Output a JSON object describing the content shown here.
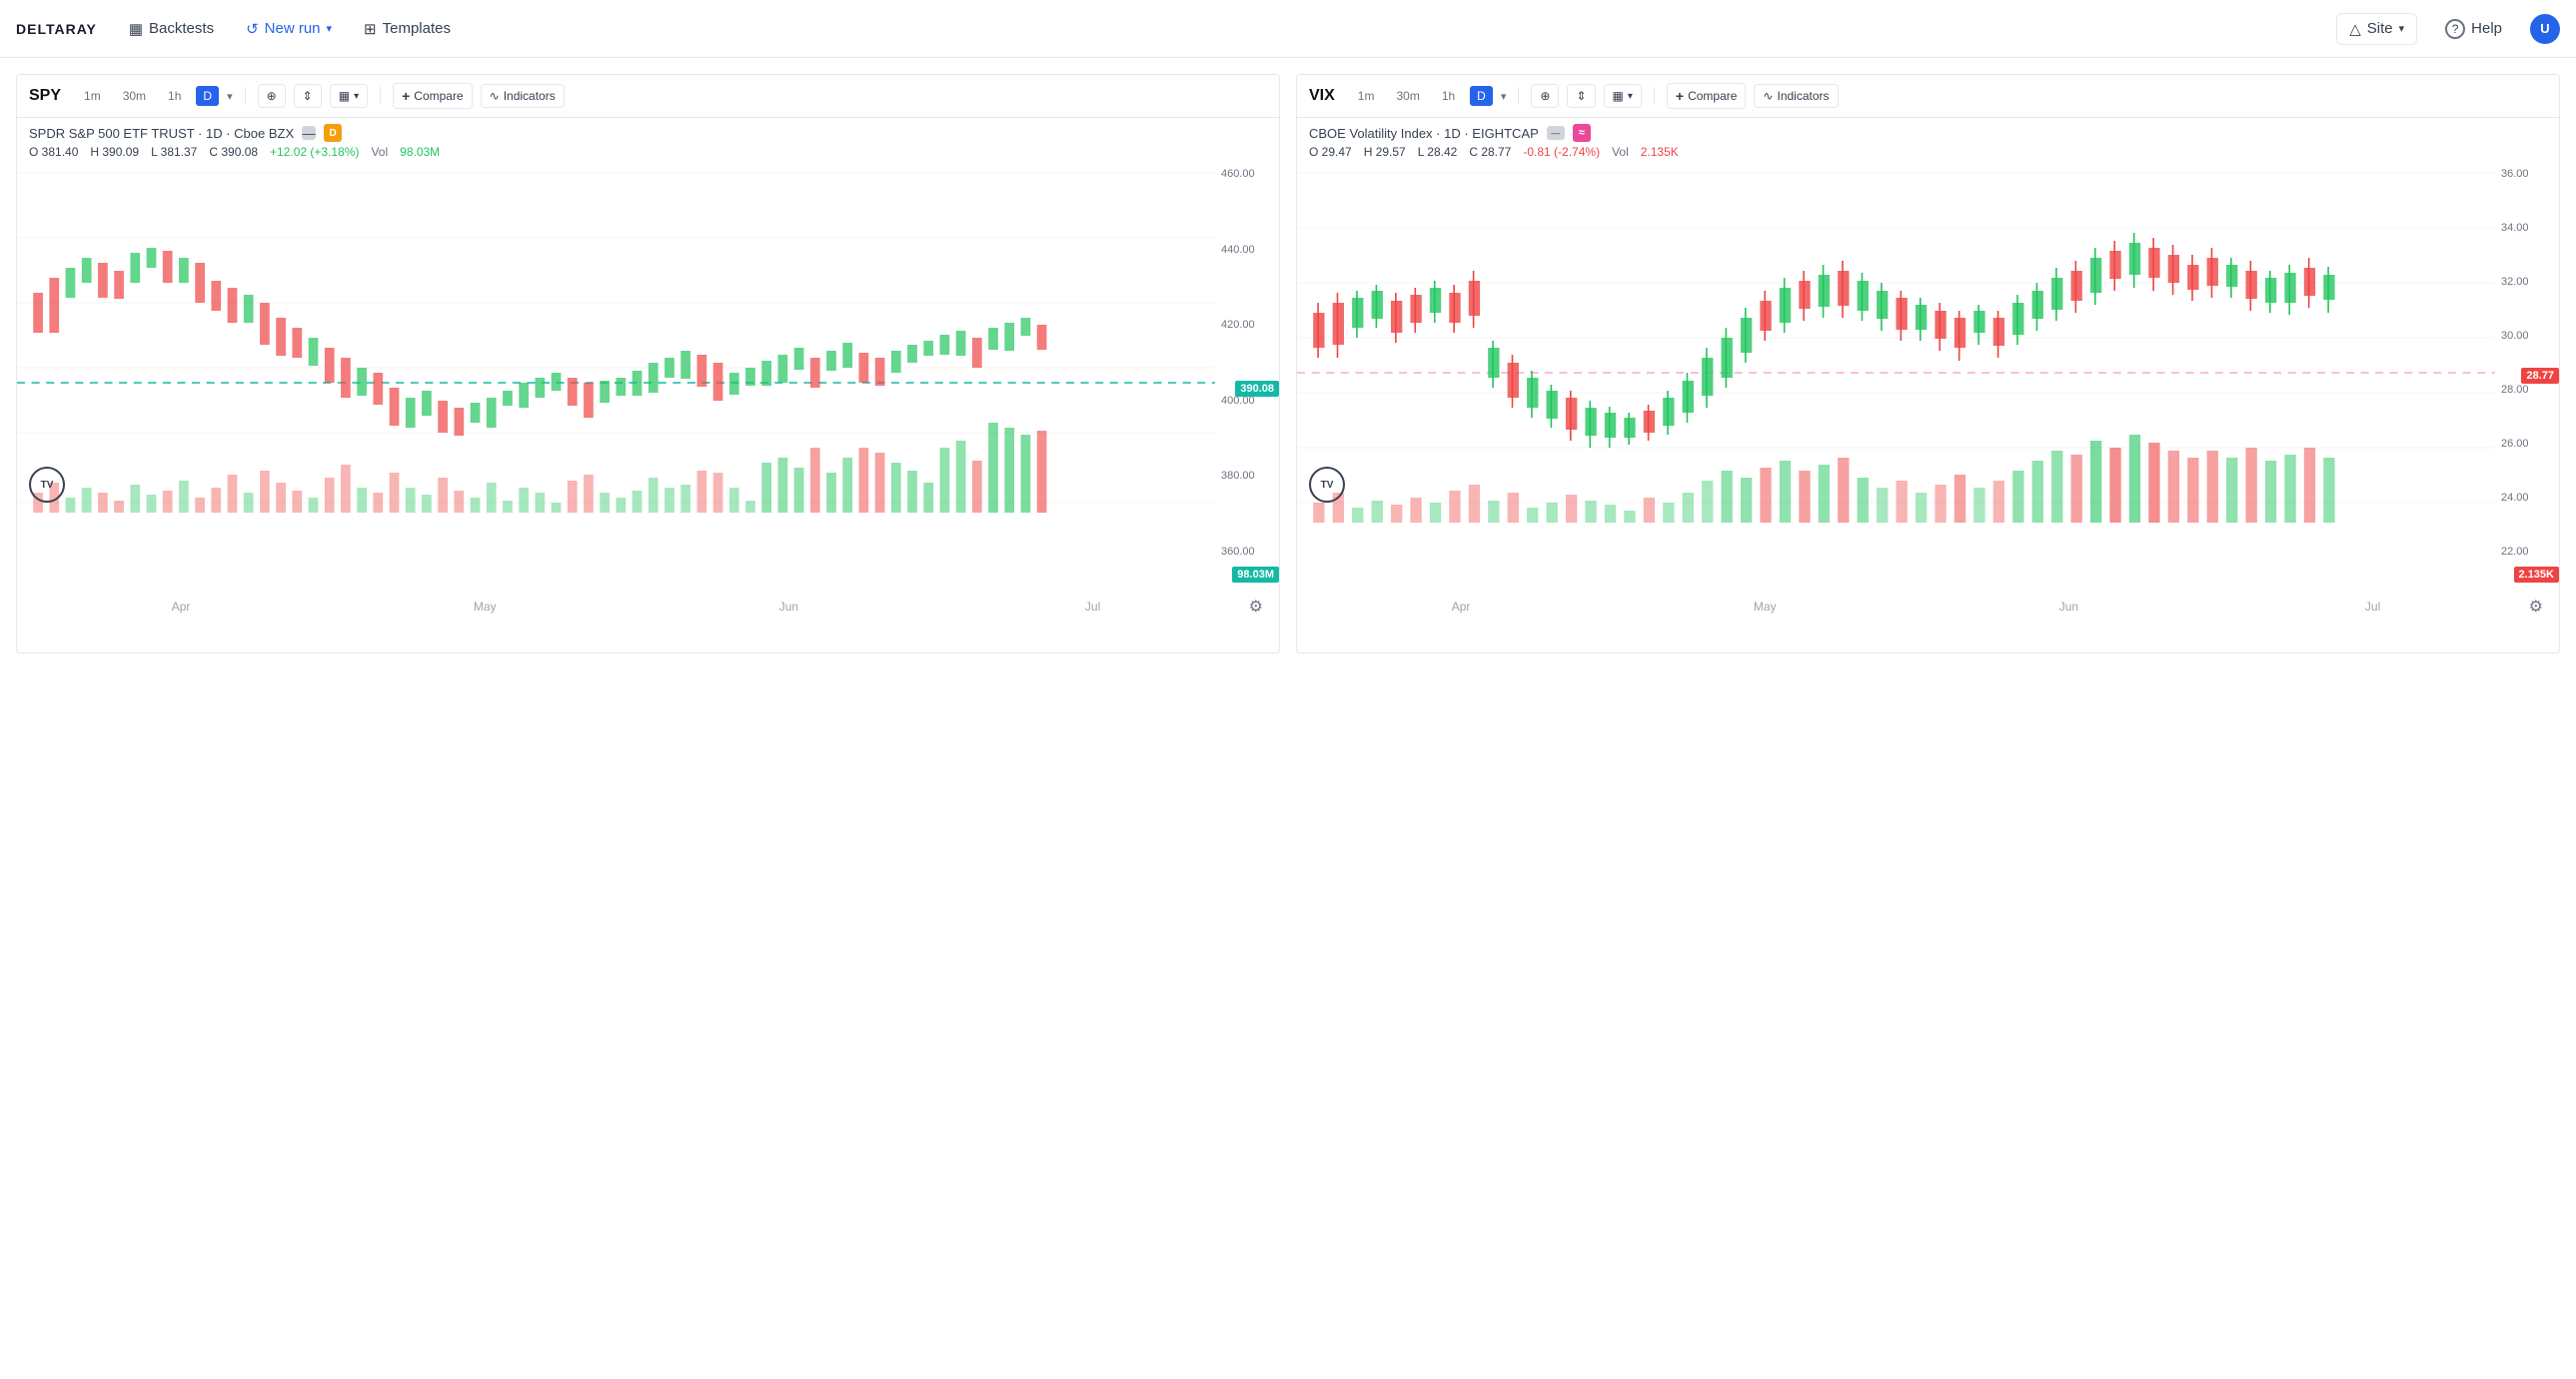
{
  "header": {
    "logo": "DELTARAY",
    "backtests_label": "Backtests",
    "new_run_label": "New run",
    "templates_label": "Templates",
    "site_label": "Site",
    "help_label": "Help"
  },
  "charts": [
    {
      "id": "spy",
      "symbol": "SPY",
      "time_options": [
        "1m",
        "30m",
        "1h",
        "D"
      ],
      "active_time": "D",
      "title": "SPDR S&P 500 ETF TRUST",
      "interval": "1D",
      "exchange": "Cboe BZX",
      "badge_text": "D",
      "badge_color": "#f59e0b",
      "o_label": "O",
      "o_val": "381.40",
      "h_label": "H",
      "h_val": "390.09",
      "l_label": "L",
      "l_val": "381.37",
      "c_label": "C",
      "c_val": "390.08",
      "chg": "+12.02 (+3.18%)",
      "vol_label": "Vol",
      "vol_val": "98.03M",
      "current_price": "390.08",
      "current_vol": "98.03M",
      "price_levels": [
        "460.00",
        "440.00",
        "420.00",
        "400.00",
        "380.00",
        "360.00"
      ],
      "months": [
        "Apr",
        "May",
        "Jun",
        "Jul"
      ],
      "hline_y_pct": 56
    },
    {
      "id": "vix",
      "symbol": "VIX",
      "time_options": [
        "1m",
        "30m",
        "1h",
        "D"
      ],
      "active_time": "D",
      "title": "CBOE Volatility Index",
      "interval": "1D",
      "exchange": "EIGHTCAP",
      "badge_text": "≈",
      "badge_color": "#ec4899",
      "o_label": "O",
      "o_val": "29.47",
      "h_label": "H",
      "h_val": "29.57",
      "l_label": "L",
      "l_val": "28.42",
      "c_label": "C",
      "c_val": "28.77",
      "chg": "-0.81 (-2.74%)",
      "vol_label": "Vol",
      "vol_val": "2.135K",
      "current_price": "28.77",
      "current_vol": "2.135K",
      "price_levels": [
        "36.00",
        "34.00",
        "32.00",
        "30.00",
        "28.00",
        "26.00",
        "24.00",
        "22.00"
      ],
      "months": [
        "Apr",
        "May",
        "Jun",
        "Jul"
      ],
      "hline_y_pct": 48
    }
  ],
  "icons": {
    "backtests": "▦",
    "new_run": "↺",
    "templates": "⊞",
    "compare_plus": "+",
    "indicators": "∿",
    "site_triangle": "△",
    "help_circle": "?",
    "crosshair": "⊕",
    "scale": "⇕",
    "chart_type": "📊",
    "gear": "⚙"
  }
}
